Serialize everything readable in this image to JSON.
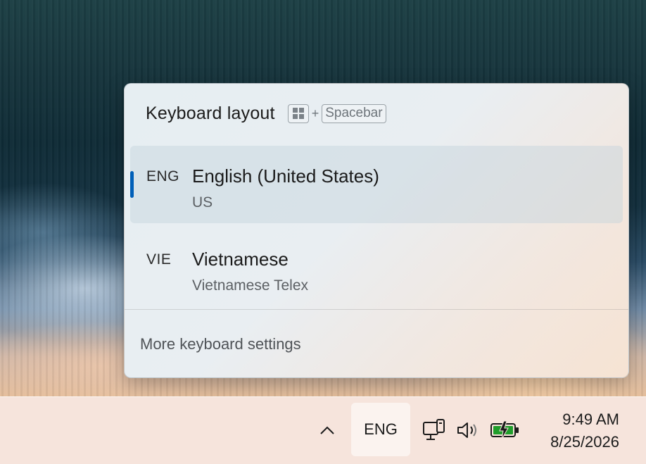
{
  "flyout": {
    "title": "Keyboard layout",
    "shortcut": {
      "plus": "+",
      "key": "Spacebar"
    },
    "layouts": [
      {
        "code": "ENG",
        "name": "English (United States)",
        "sub": "US",
        "selected": true
      },
      {
        "code": "VIE",
        "name": "Vietnamese",
        "sub": "Vietnamese Telex",
        "selected": false
      }
    ],
    "more_settings": "More keyboard settings",
    "accent_color": "#005fb8"
  },
  "taskbar": {
    "overflow_icon": "chevron-up-icon",
    "language_button": "ENG",
    "tray_icons": [
      "network-icon",
      "volume-icon",
      "battery-charging-icon"
    ],
    "time": "9:49 AM",
    "date": "8/25/2026",
    "battery_color": "#1f9d2b"
  }
}
